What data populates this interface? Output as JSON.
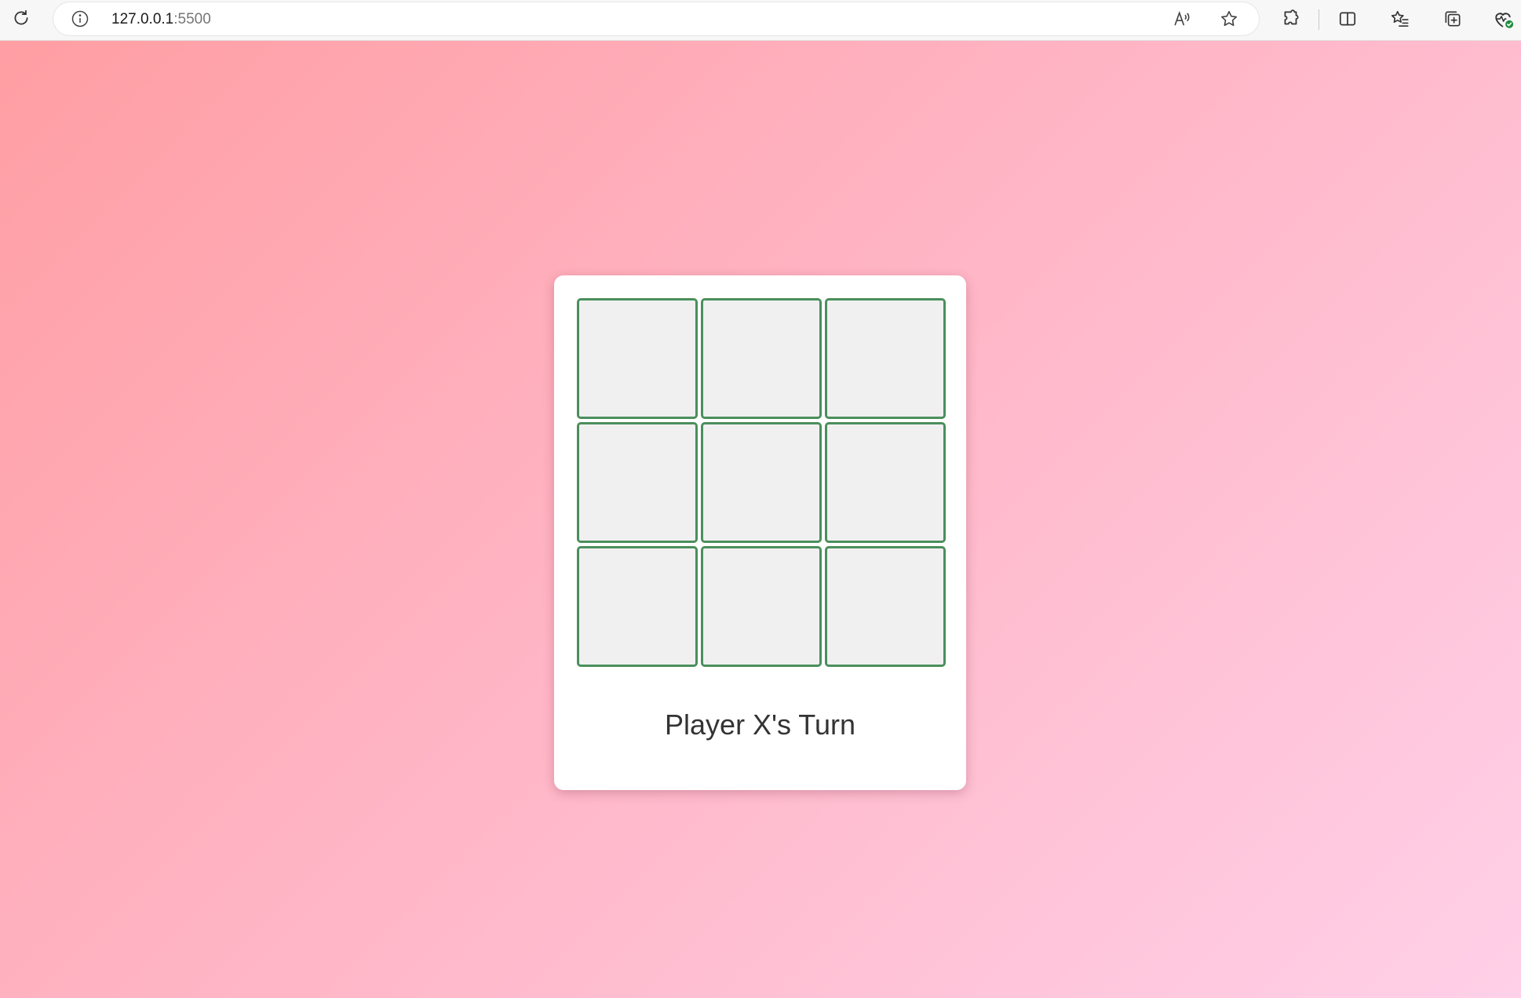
{
  "browser": {
    "url_host": "127.0.0.1",
    "url_port": ":5500",
    "icons": [
      "reload-icon",
      "site-info-icon",
      "read-aloud-icon",
      "favorite-star-icon",
      "extensions-icon",
      "split-screen-icon",
      "favorites-icon",
      "collections-icon",
      "browser-essentials-icon"
    ]
  },
  "game": {
    "board": {
      "cells": [
        "",
        "",
        "",
        "",
        "",
        "",
        "",
        "",
        ""
      ]
    },
    "status": "Player X's Turn"
  },
  "colors": {
    "cell_border": "#4a8f5c",
    "cell_background": "#f0f0f0",
    "background_start": "#ff9ea3",
    "background_end": "#ffd0e8",
    "card_background": "#ffffff"
  }
}
